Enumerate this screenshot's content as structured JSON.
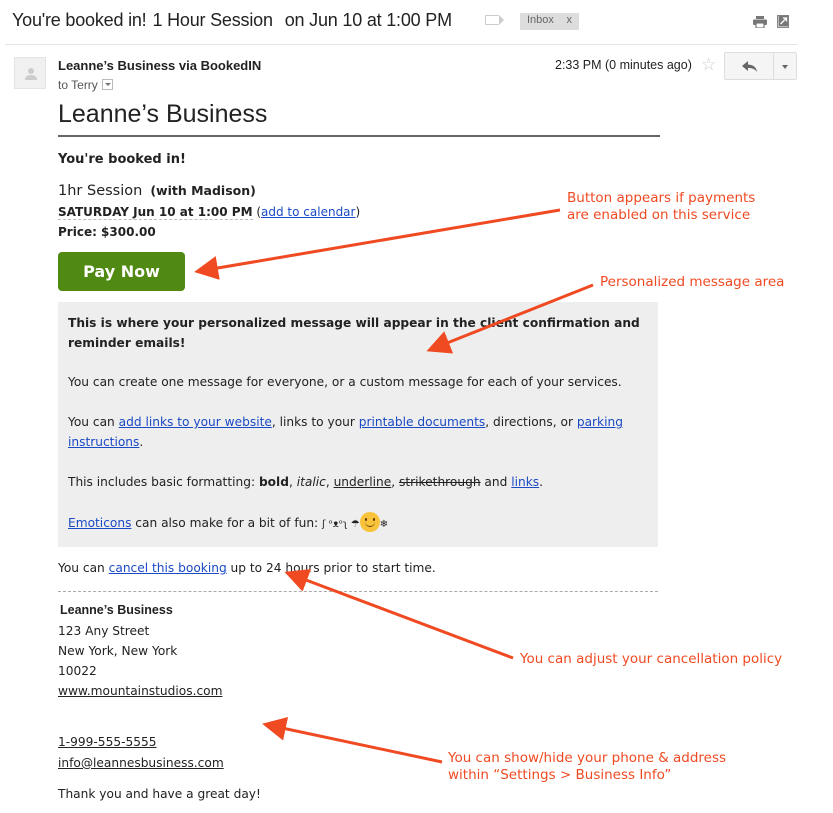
{
  "email": {
    "subject": {
      "part1": "You're booked in!",
      "part2": "1 Hour Session",
      "part3": "on Jun 10 at 1:00 PM"
    },
    "label_chip": {
      "text": "Inbox",
      "remove": "x"
    },
    "toolbar_icons": [
      "print-icon",
      "popout-icon",
      "label-icon"
    ],
    "sender": "Leanne’s Business via BookedIN",
    "to_prefix": "to",
    "recipient": "Terry",
    "timestamp": "2:33 PM (0 minutes ago)",
    "star_icon": "☆",
    "reply_icon": "reply-icon"
  },
  "body": {
    "business_title": "Leanne’s Business",
    "booked_heading": "You're booked in!",
    "session_name": "1hr Session",
    "with_staff": "(with Madison)",
    "date_time": "SATURDAY Jun 10 at 1:00 PM",
    "calendar_open": "(",
    "calendar_link": "add to calendar",
    "calendar_close": ")",
    "price": "Price: $300.00",
    "pay_button": "Pay Now",
    "message": {
      "p1": "This is where your personalized message will appear in the client confirmation and reminder emails!",
      "p2": "You can create one message for everyone, or a custom message for each of your services.",
      "p3_a": "You can ",
      "p3_link1": "add links to your website",
      "p3_b": ", links to your ",
      "p3_link2": "printable documents",
      "p3_c": ", directions, or ",
      "p3_link3": "parking instructions",
      "p3_d": ".",
      "p4_a": "This includes basic formatting: ",
      "p4_bold": "bold",
      "p4_sep1": ", ",
      "p4_italic": "italic",
      "p4_sep2": ", ",
      "p4_underline": "underline",
      "p4_sep3": ", ",
      "p4_strike": "strikethrough",
      "p4_and": " and ",
      "p4_link": "links",
      "p4_end": ".",
      "p5_link": "Emoticons",
      "p5_text": " can also make for a bit of fun: ",
      "p5_emoji_text": "ʃ ᵒᴥᵒʅ ☂",
      "p5_emoji_tail": "❄"
    },
    "cancel": {
      "prefix": "You can ",
      "link": "cancel this booking",
      "suffix": " up to 24 hours prior to start time."
    },
    "footer": {
      "name": "Leanne’s Business",
      "street": "123 Any Street",
      "city": "New York, New York",
      "zip": "10022",
      "website": "www.mountainstudios.com",
      "phone": "1-999-555-5555",
      "email": "info@leannesbusiness.com",
      "thanks": "Thank you and have a great day!"
    }
  },
  "annotations": {
    "color": "#f04a22",
    "pay_button_note_1": "Button appears if payments",
    "pay_button_note_2": "are enabled on this service",
    "message_note": "Personalized message area",
    "cancel_note": "You can adjust your cancellation policy",
    "contact_note_1": "You can show/hide your phone & address",
    "contact_note_2": "within “Settings > Business Info”"
  },
  "colors": {
    "pay_button": "#508a12",
    "message_box": "#eeeeee",
    "link": "#1a4ac4"
  }
}
